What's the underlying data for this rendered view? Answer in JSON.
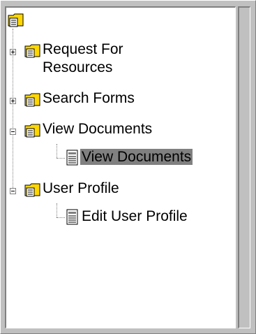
{
  "tree": {
    "root": {
      "icon": "folder-document-icon"
    },
    "items": [
      {
        "label": "Request For Resources",
        "icon": "folder-document-icon",
        "expander": "plus"
      },
      {
        "label": "Search Forms",
        "icon": "folder-document-icon",
        "expander": "plus"
      },
      {
        "label": "View Documents",
        "icon": "folder-document-icon",
        "expander": "minus",
        "children": [
          {
            "label": "View Documents",
            "icon": "document-icon",
            "selected": true
          }
        ]
      },
      {
        "label": "User Profile",
        "icon": "folder-document-icon",
        "expander": "minus",
        "children": [
          {
            "label": "Edit User Profile",
            "icon": "document-icon"
          }
        ]
      }
    ]
  },
  "colors": {
    "folder": "#ffd700",
    "selection": "#808080",
    "window": "#c0c0c0"
  }
}
